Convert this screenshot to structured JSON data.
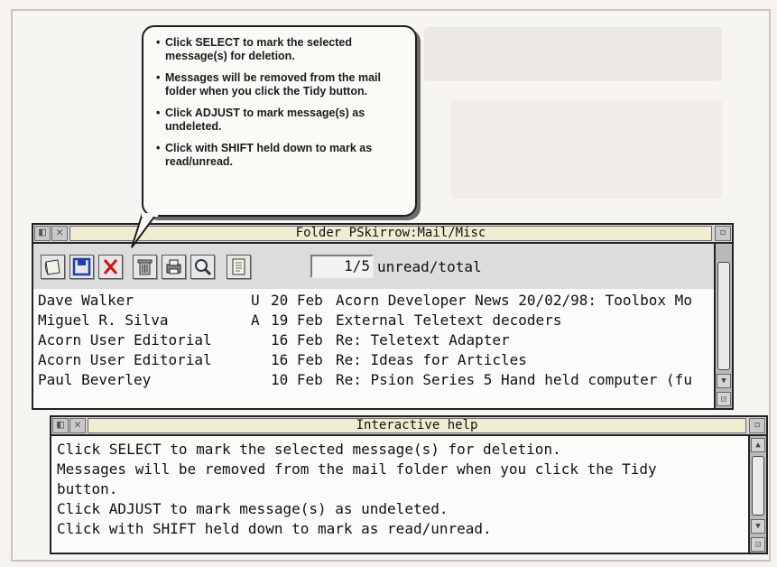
{
  "balloon": {
    "items": [
      "Click SELECT to mark the selected message(s) for deletion.",
      "Messages will be removed from the mail folder when you click the Tidy button.",
      "Click ADJUST to mark message(s) as undeleted.",
      "Click with SHIFT held down to mark as read/unread."
    ]
  },
  "folder_window": {
    "title": "Folder PSkirrow:Mail/Misc",
    "toolbar": {
      "icons": [
        "compose-icon",
        "save-icon",
        "delete-icon",
        "trash-icon",
        "print-icon",
        "search-icon",
        "notes-icon"
      ],
      "count_value": "1/5",
      "count_label": "unread/total"
    },
    "messages": [
      {
        "from": "Dave Walker",
        "flag": "U",
        "date": "20 Feb",
        "subject": "Acorn Developer News 20/02/98: Toolbox Mo"
      },
      {
        "from": "Miguel R. Silva",
        "flag": "A",
        "date": "19 Feb",
        "subject": "External Teletext decoders"
      },
      {
        "from": "Acorn User Editorial",
        "flag": "",
        "date": "16 Feb",
        "subject": "Re: Teletext Adapter"
      },
      {
        "from": "Acorn User Editorial",
        "flag": "",
        "date": "16 Feb",
        "subject": "Re: Ideas for Articles"
      },
      {
        "from": "Paul Beverley",
        "flag": "",
        "date": "10 Feb",
        "subject": "Re: Psion Series 5 Hand held computer (fu"
      }
    ]
  },
  "help_window": {
    "title": "Interactive help",
    "lines": [
      "Click SELECT to mark the selected message(s) for deletion.",
      "Messages will be removed from the mail folder when you click the Tidy",
      "button.",
      "Click ADJUST to mark message(s) as undeleted.",
      "Click with SHIFT held down to mark as read/unread."
    ]
  },
  "colors": {
    "title_bg": "#f1edd2",
    "delete_red": "#d21414",
    "save_blue": "#1f3fb0"
  }
}
